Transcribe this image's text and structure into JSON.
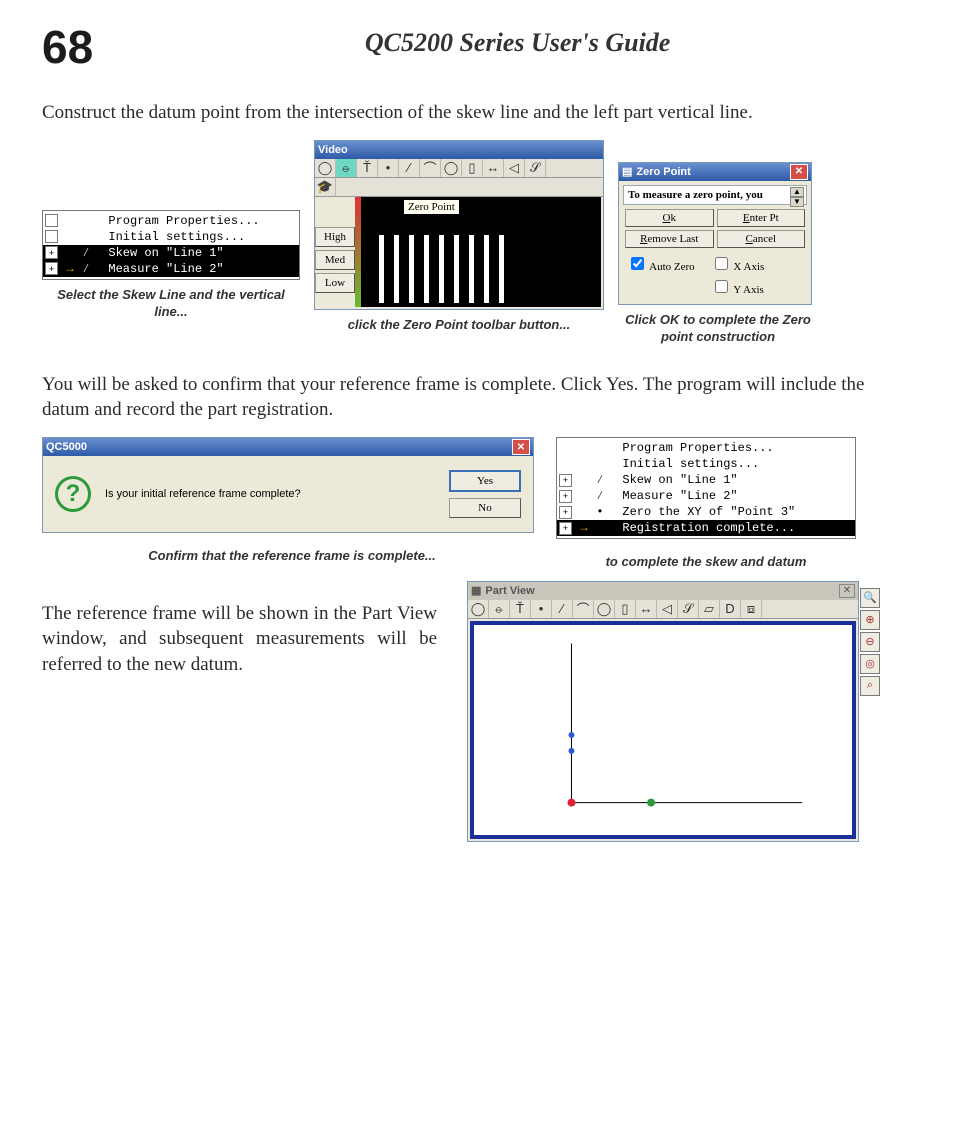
{
  "page": {
    "number": "68",
    "doc_title": "QC5200 Series User's Guide"
  },
  "para1": "Construct the datum point from the intersection of the skew line and the left part vertical line.",
  "tree1": {
    "items": [
      {
        "text": "Program Properties...",
        "sel": false,
        "exp": " ",
        "ic": " "
      },
      {
        "text": "Initial settings...",
        "sel": false,
        "exp": " ",
        "ic": " "
      },
      {
        "text": "Skew on \"Line 1\"",
        "sel": true,
        "exp": "+",
        "ic": "∕"
      },
      {
        "text": "Measure \"Line 2\"",
        "sel": true,
        "exp": "+",
        "ic": "∕",
        "arrow": true
      }
    ],
    "caption": "Select the Skew Line and the vertical line..."
  },
  "video": {
    "title": "Video",
    "tooltip": "Zero Point",
    "side": [
      "High",
      "Med",
      "Low"
    ],
    "caption": "click the Zero Point toolbar button..."
  },
  "zp": {
    "title": "Zero Point",
    "hint": "To measure a zero point, you",
    "buttons": {
      "ok": "Ok",
      "enter": "Enter Pt",
      "remove": "Remove Last",
      "cancel": "Cancel"
    },
    "checks": {
      "auto": "Auto Zero",
      "x": "X Axis",
      "y": "Y Axis"
    },
    "caption": "Click OK to complete the Zero point construction"
  },
  "para2": "You will be asked to confirm that your reference frame is complete.  Click Yes.  The program will include the datum and record the part registration.",
  "confirm": {
    "title": "QC5000",
    "msg": "Is your initial reference frame complete?",
    "yes": "Yes",
    "no": "No",
    "caption": "Confirm that the reference frame is complete..."
  },
  "tree2": {
    "items": [
      {
        "text": "Program Properties...",
        "sel": false,
        "ic": " "
      },
      {
        "text": "Initial settings...",
        "sel": false,
        "ic": " "
      },
      {
        "text": "Skew on \"Line 1\"",
        "sel": false,
        "exp": "+",
        "ic": "∕"
      },
      {
        "text": "Measure \"Line 2\"",
        "sel": false,
        "exp": "+",
        "ic": "∕"
      },
      {
        "text": "Zero the XY of \"Point 3\"",
        "sel": false,
        "exp": "+",
        "ic": "•"
      },
      {
        "text": "Registration complete...",
        "sel": true,
        "exp": "+",
        "ic": " ",
        "arrow": true
      }
    ],
    "caption": "to complete the skew and datum"
  },
  "para3": "The reference frame will be shown in the Part View window, and subsequent measurements will be referred to the new datum.",
  "pv": {
    "title": "Part View"
  }
}
